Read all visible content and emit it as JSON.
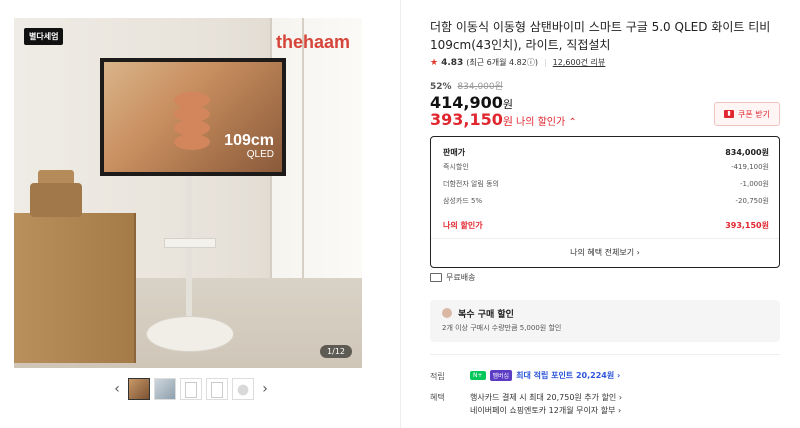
{
  "gallery": {
    "badge": "별다세엄",
    "brand": "thehaam",
    "tv_label_main": "109cm",
    "tv_label_sub": "QLED",
    "counter": "1/12",
    "prev_arrow": "‹",
    "next_arrow": "›"
  },
  "product": {
    "title": "더함 이동식 이동형 삼탠바이미 스마트 구글 5.0 QLED 화이트 티비 109cm(43인치), 라이트, 직접설치",
    "rating": "4.83",
    "rating_recent": "(최근 6개월 4.82ⓘ)",
    "reviews": "12,600건 리뷰",
    "discount_pct": "52%",
    "original_price": "834,000원",
    "price": "414,900",
    "price_unit": "원",
    "my_price": "393,150",
    "my_price_unit": "원",
    "my_price_label": "나의 할인가 ⌃",
    "coupon_label": "쿠폰 받기",
    "coupon_icon": "coupon-icon"
  },
  "breakdown": {
    "rows": [
      {
        "label": "판매가",
        "value": "834,000원"
      },
      {
        "label": "즉시할인",
        "value": "-419,100원"
      },
      {
        "label": "더함전자 알림 동의",
        "value": "-1,000원"
      },
      {
        "label": "삼성카드 5%",
        "value": "-20,750원"
      }
    ],
    "my_price_label": "나의 할인가",
    "my_price_value": "393,150원",
    "more": "나의 혜택 전체보기 ›"
  },
  "shipping": "무료배송",
  "multi": {
    "title": "복수 구매 할인",
    "desc": "2개 이상 구매시 수량만큼 5,000원 할인"
  },
  "points": {
    "label": "적립",
    "badge1": "N+",
    "badge2": "멤버십",
    "text": "최대 적립 포인트 20,224원 ›"
  },
  "benefits": {
    "label": "혜택",
    "line1": "행사카드 결제 시 최대 20,750원 추가 할인 ›",
    "line2": "네이버페이 쇼핑엔토카 12개월 무이자 할부 ›"
  }
}
